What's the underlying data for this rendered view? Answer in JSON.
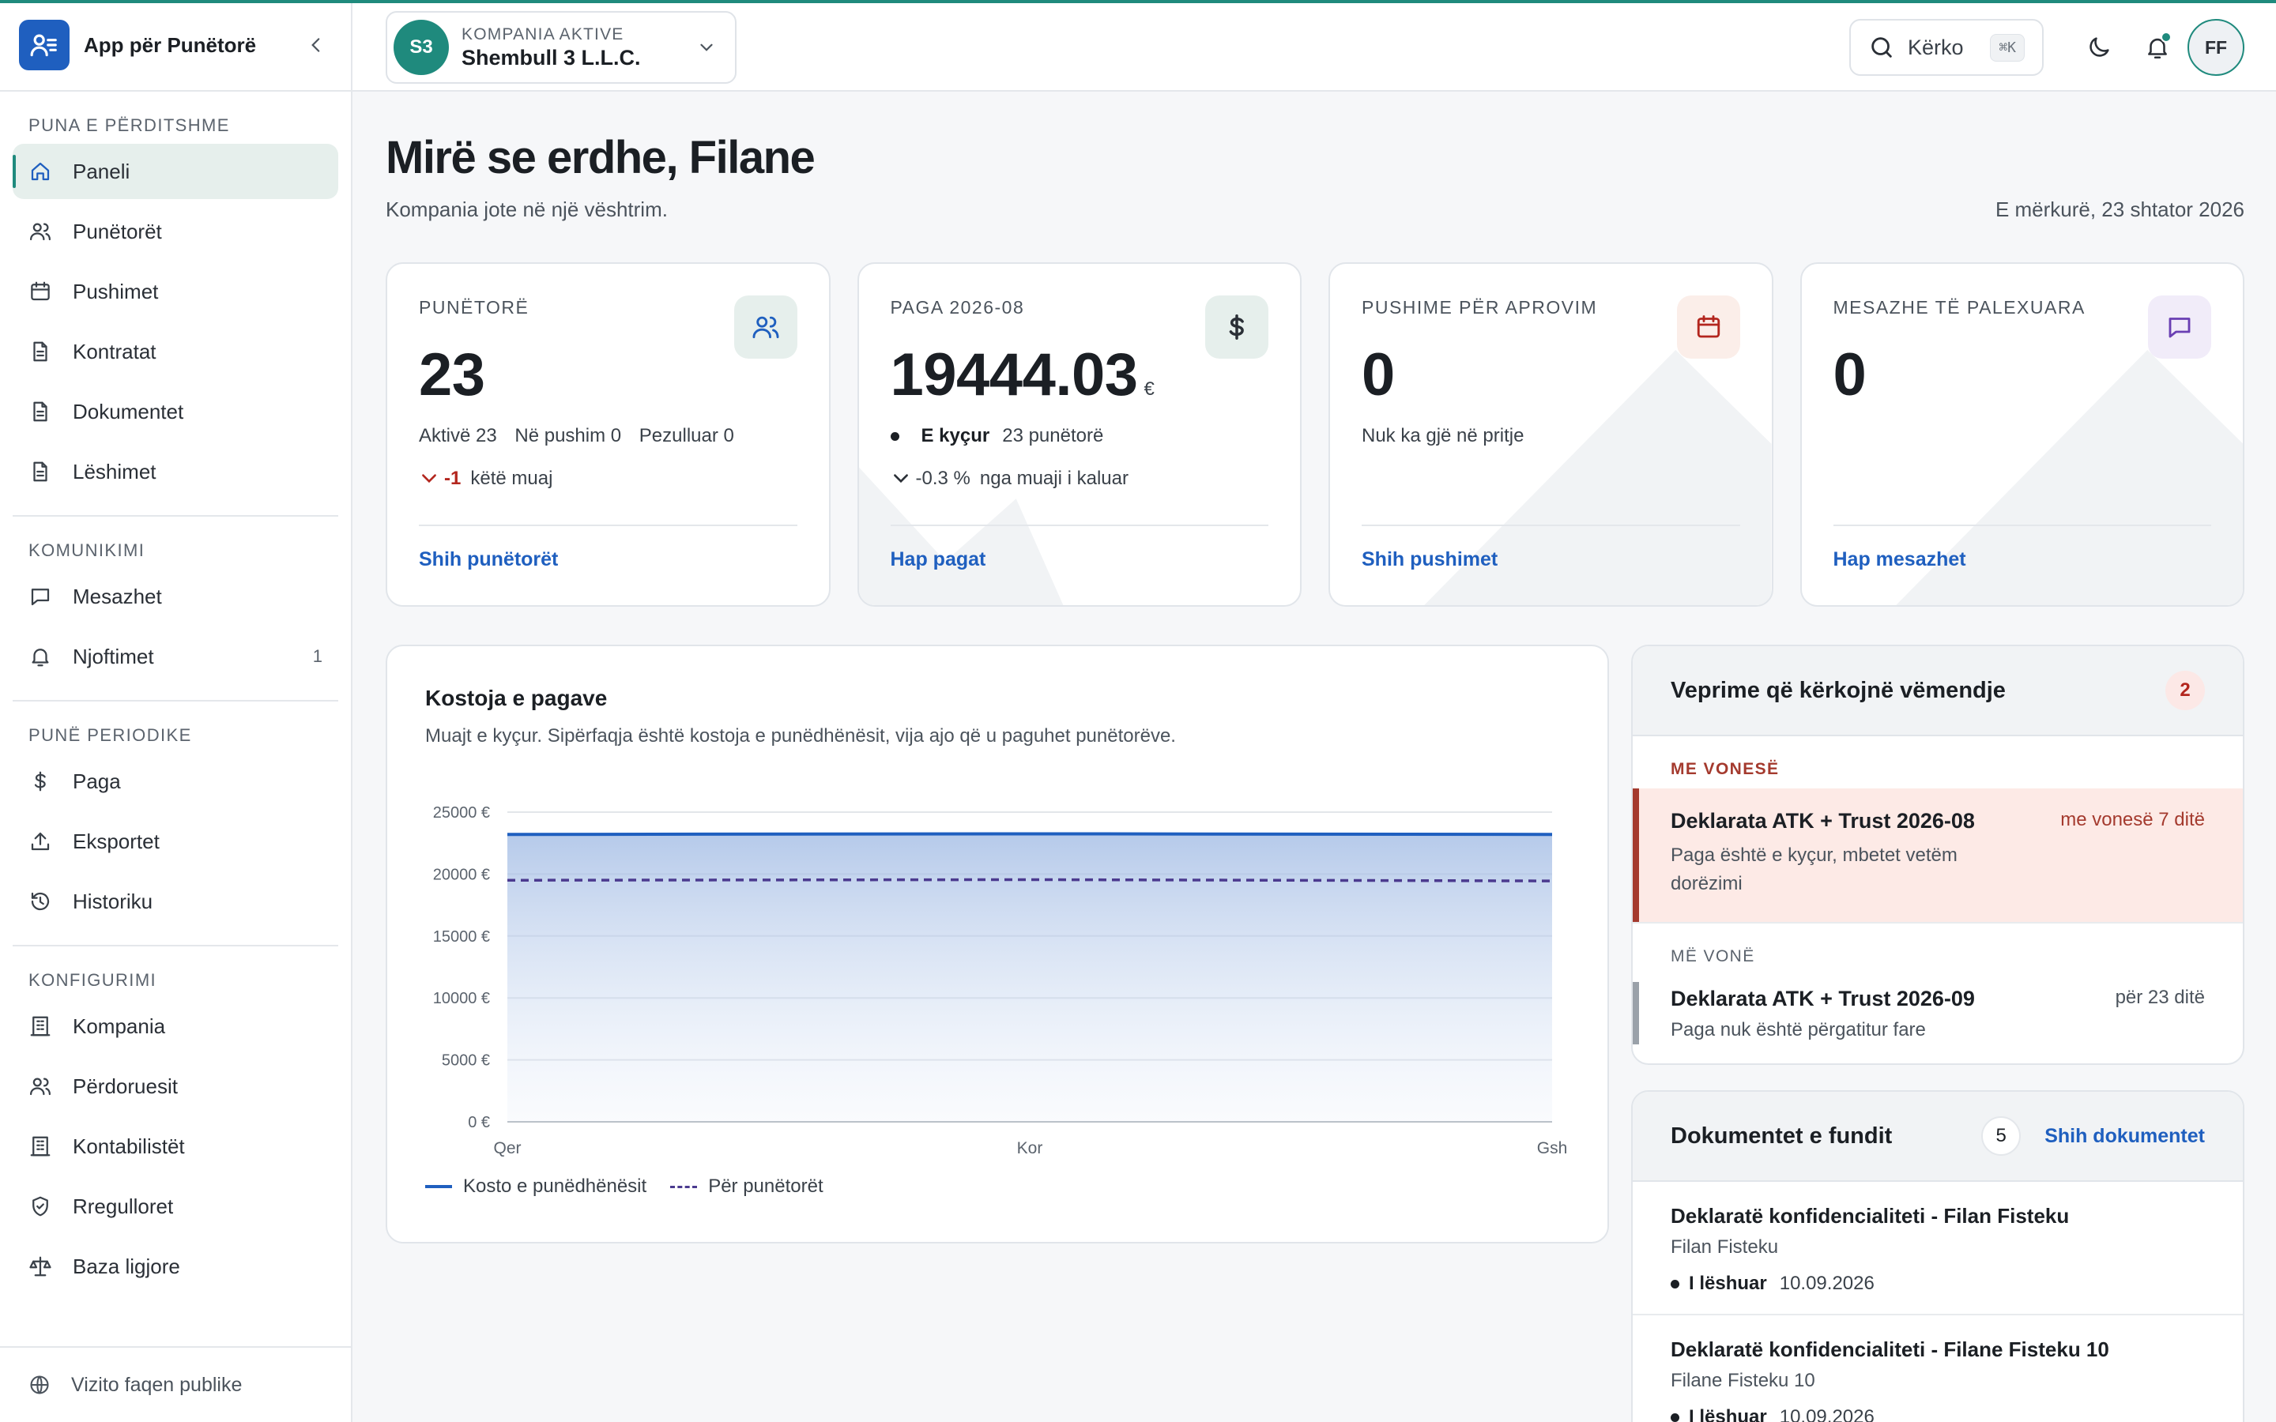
{
  "colors": {
    "accent": "#1f8a7d",
    "brand": "#1f5fbf",
    "danger": "#b3261e",
    "purple": "#6a3fb3"
  },
  "app": {
    "name": "App për Punëtorë"
  },
  "sidebar": {
    "sections": [
      {
        "title": "Puna e përditshme",
        "items": [
          {
            "label": "Paneli",
            "icon": "home-icon",
            "active": true
          },
          {
            "label": "Punëtorët",
            "icon": "users-icon"
          },
          {
            "label": "Pushimet",
            "icon": "calendar-icon"
          },
          {
            "label": "Kontratat",
            "icon": "file-icon"
          },
          {
            "label": "Dokumentet",
            "icon": "file-icon"
          },
          {
            "label": "Lëshimet",
            "icon": "file-icon"
          }
        ]
      },
      {
        "title": "Komunikimi",
        "items": [
          {
            "label": "Mesazhet",
            "icon": "message-icon"
          },
          {
            "label": "Njoftimet",
            "icon": "bell-icon",
            "count": "1"
          }
        ]
      },
      {
        "title": "Punë periodike",
        "items": [
          {
            "label": "Paga",
            "icon": "dollar-icon"
          },
          {
            "label": "Eksportet",
            "icon": "upload-icon"
          },
          {
            "label": "Historiku",
            "icon": "history-icon"
          }
        ]
      },
      {
        "title": "Konfigurimi",
        "items": [
          {
            "label": "Kompania",
            "icon": "building-icon"
          },
          {
            "label": "Përdoruesit",
            "icon": "users-icon"
          },
          {
            "label": "Kontabilistët",
            "icon": "building-icon"
          },
          {
            "label": "Rregulloret",
            "icon": "shield-icon"
          },
          {
            "label": "Baza ligjore",
            "icon": "scale-icon"
          }
        ]
      }
    ],
    "footer": {
      "label": "Vizito faqen publike",
      "icon": "globe-icon"
    }
  },
  "topbar": {
    "company_caption": "Kompania aktive",
    "company_name": "Shembull 3 L.L.C.",
    "company_initials": "S3",
    "search_label": "Kërko",
    "search_shortcut": "⌘K",
    "user_initials": "FF"
  },
  "main": {
    "welcome": "Mirë se erdhe, Filane",
    "subtitle": "Kompania jote në një vështrim.",
    "date": "E mërkurë, 23 shtator 2026"
  },
  "cards": [
    {
      "caption": "Punëtorë",
      "value": "23",
      "line": [
        "Aktivë 23",
        "Në pushim 0",
        "Pezulluar 0"
      ],
      "trend_value": "-1",
      "trend_text": "këtë muaj",
      "link": "Shih punëtorët",
      "icon": "users-icon"
    },
    {
      "caption": "Paga 2026-08",
      "value": "19444.03",
      "currency": "€",
      "status": "E kyçur",
      "status_extra": "23 punëtorë",
      "trend_value": "-0.3 %",
      "trend_text": "nga muaji i kaluar",
      "link": "Hap pagat",
      "icon": "dollar-icon"
    },
    {
      "caption": "Pushime për aprovim",
      "value": "0",
      "line": [
        "Nuk ka gjë në pritje"
      ],
      "link": "Shih pushimet",
      "icon": "calendar-icon"
    },
    {
      "caption": "Mesazhe të palexuara",
      "value": "0",
      "link": "Hap mesazhet",
      "icon": "message-icon"
    }
  ],
  "chart": {
    "title": "Kostoja e pagave",
    "subtitle": "Muajt e kyçur. Sipërfaqja është kostoja e punëdhënësit, vija ajo që u paguhet punëtorëve.",
    "legend_employer": "Kosto e punëdhënësit",
    "legend_workers": "Për punëtorët"
  },
  "chart_data": {
    "type": "area",
    "x": [
      "Qer",
      "Kor",
      "Gsh"
    ],
    "series": [
      {
        "name": "Kosto e punëdhënësit",
        "values": [
          23200,
          23250,
          23200
        ],
        "style": "area"
      },
      {
        "name": "Për punëtorët",
        "values": [
          19500,
          19550,
          19444.03
        ],
        "style": "dashed-line"
      }
    ],
    "ylim": [
      0,
      25000
    ],
    "yticks": [
      "25000 €",
      "20000 €",
      "15000 €",
      "10000 €",
      "5000 €",
      "0 €"
    ],
    "grid": true,
    "legend_position": "bottom-left"
  },
  "attention": {
    "title": "Veprime që kërkojnë vëmendje",
    "count": "2",
    "groups": [
      {
        "caption": "Me vonesë",
        "items": [
          {
            "title": "Deklarata ATK + Trust 2026-08",
            "right": "me vonesë 7 ditë",
            "desc": "Paga është e kyçur, mbetet vetëm dorëzimi"
          }
        ]
      },
      {
        "caption": "Më vonë",
        "items": [
          {
            "title": "Deklarata ATK + Trust 2026-09",
            "right": "për 23 ditë",
            "desc": "Paga nuk është përgatitur fare"
          }
        ]
      }
    ]
  },
  "documents": {
    "title": "Dokumentet e fundit",
    "count": "5",
    "link": "Shih dokumentet",
    "items": [
      {
        "title": "Deklaratë konfidencialiteti - Filan Fisteku",
        "person": "Filan Fisteku",
        "status": "I lëshuar",
        "date": "10.09.2026"
      },
      {
        "title": "Deklaratë konfidencialiteti - Filane Fisteku 10",
        "person": "Filane Fisteku 10",
        "status": "I lëshuar",
        "date": "10.09.2026"
      }
    ]
  }
}
